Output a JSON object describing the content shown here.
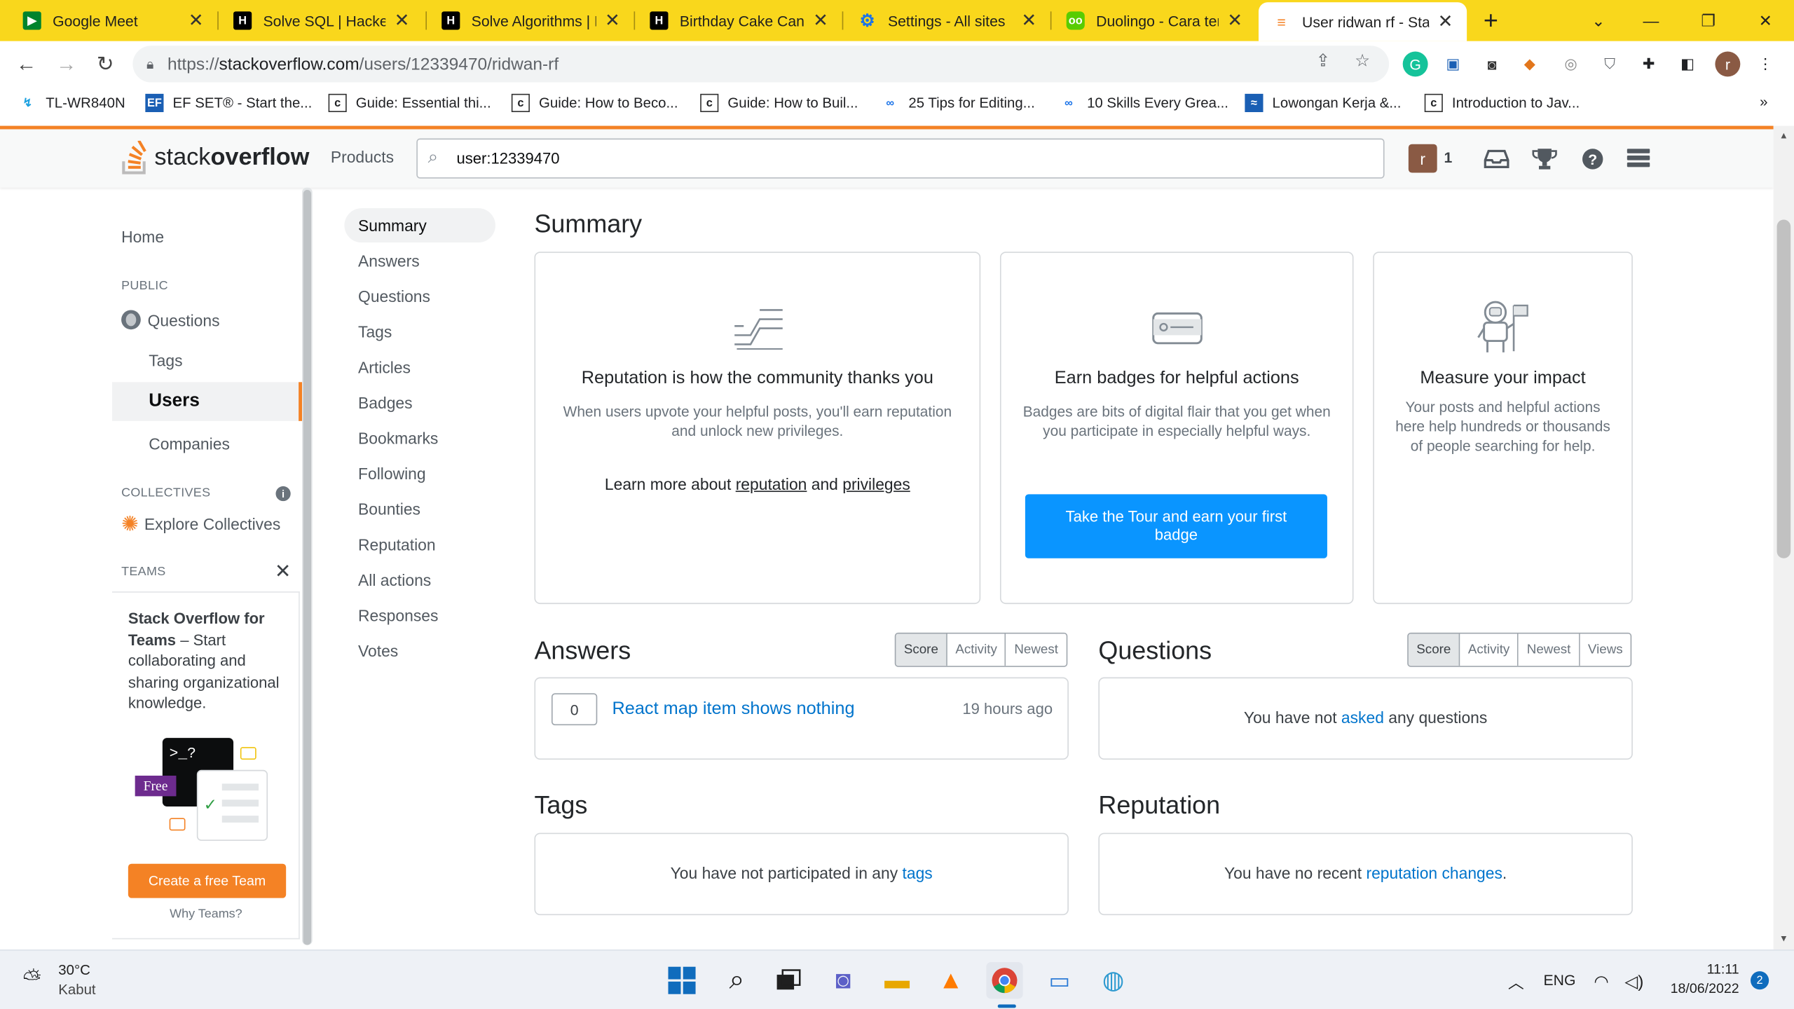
{
  "browser": {
    "tabs": [
      {
        "title": "Google Meet",
        "icon": "google-meet-icon"
      },
      {
        "title": "Solve SQL | HackerR",
        "icon": "hackerrank-icon"
      },
      {
        "title": "Solve Algorithms | H",
        "icon": "hackerrank-icon"
      },
      {
        "title": "Birthday Cake Cand",
        "icon": "hackerrank-icon"
      },
      {
        "title": "Settings - All sites",
        "icon": "gear-icon"
      },
      {
        "title": "Duolingo - Cara ter",
        "icon": "duolingo-icon"
      },
      {
        "title": "User ridwan rf - Sta",
        "icon": "stackoverflow-icon"
      }
    ],
    "url": "https://stackoverflow.com/users/12339470/ridwan-rf",
    "url_prefix": "https://",
    "url_host": "stackoverflow.com",
    "url_path": "/users/12339470/ridwan-rf",
    "profile_initial": "r",
    "bookmarks": [
      "TL-WR840N",
      "EF SET® - Start the...",
      "Guide: Essential thi...",
      "Guide: How to Beco...",
      "Guide: How to Buil...",
      "25 Tips for Editing...",
      "10 Skills Every Grea...",
      "Lowongan Kerja &...",
      "Introduction to Jav..."
    ],
    "bookmarks_more": "»"
  },
  "so_header": {
    "logo_light": "stack",
    "logo_bold": "overflow",
    "products": "Products",
    "search_value": "user:12339470",
    "avatar_initial": "r",
    "rep": "1"
  },
  "left_nav": {
    "home": "Home",
    "public": "PUBLIC",
    "questions": "Questions",
    "tags": "Tags",
    "users": "Users",
    "companies": "Companies",
    "collectives": "COLLECTIVES",
    "explore": "Explore Collectives",
    "teams": "TEAMS",
    "teams_title": "Stack Overflow for Teams",
    "teams_desc": " – Start collaborating and sharing organizational knowledge.",
    "free": "Free",
    "prompt": ">_?",
    "create_team": "Create a free Team",
    "why_teams": "Why Teams?"
  },
  "profile_nav": [
    "Summary",
    "Answers",
    "Questions",
    "Tags",
    "Articles",
    "Badges",
    "Bookmarks",
    "Following",
    "Bounties",
    "Reputation",
    "All actions",
    "Responses",
    "Votes"
  ],
  "summary": {
    "heading": "Summary",
    "rep_card": {
      "title": "Reputation is how the community thanks you",
      "desc": "When users upvote your helpful posts, you'll earn reputation and unlock new privileges.",
      "learn_prefix": "Learn more about ",
      "reputation_link": "reputation",
      "and": " and ",
      "privileges_link": "privileges"
    },
    "badge_card": {
      "title": "Earn badges for helpful actions",
      "desc": "Badges are bits of digital flair that you get when you participate in especially helpful ways.",
      "button": "Take the Tour and earn your first badge"
    },
    "impact_card": {
      "title": "Measure your impact",
      "desc": "Your posts and helpful actions here help hundreds or thousands of people searching for help."
    }
  },
  "answers": {
    "heading": "Answers",
    "sort": [
      "Score",
      "Activity",
      "Newest"
    ],
    "items": [
      {
        "score": "0",
        "title": "React map item shows nothing",
        "time": "19 hours ago"
      }
    ]
  },
  "questions": {
    "heading": "Questions",
    "sort": [
      "Score",
      "Activity",
      "Newest",
      "Views"
    ],
    "empty_prefix": "You have not ",
    "empty_link": "asked",
    "empty_suffix": " any questions"
  },
  "tags": {
    "heading": "Tags",
    "empty_prefix": "You have not participated in any ",
    "empty_link": "tags"
  },
  "reputation": {
    "heading": "Reputation",
    "empty_prefix": "You have no recent ",
    "empty_link": "reputation changes",
    "empty_suffix": "."
  },
  "taskbar": {
    "weather_temp": "30°C",
    "weather_desc": "Kabut",
    "lang": "ENG",
    "time": "11:11",
    "date": "18/06/2022",
    "notif_count": "2"
  },
  "colors": {
    "tabstrip": "#f9d71c",
    "so_orange": "#f48225",
    "so_blue": "#0a95ff",
    "link_blue": "#0074cc"
  }
}
